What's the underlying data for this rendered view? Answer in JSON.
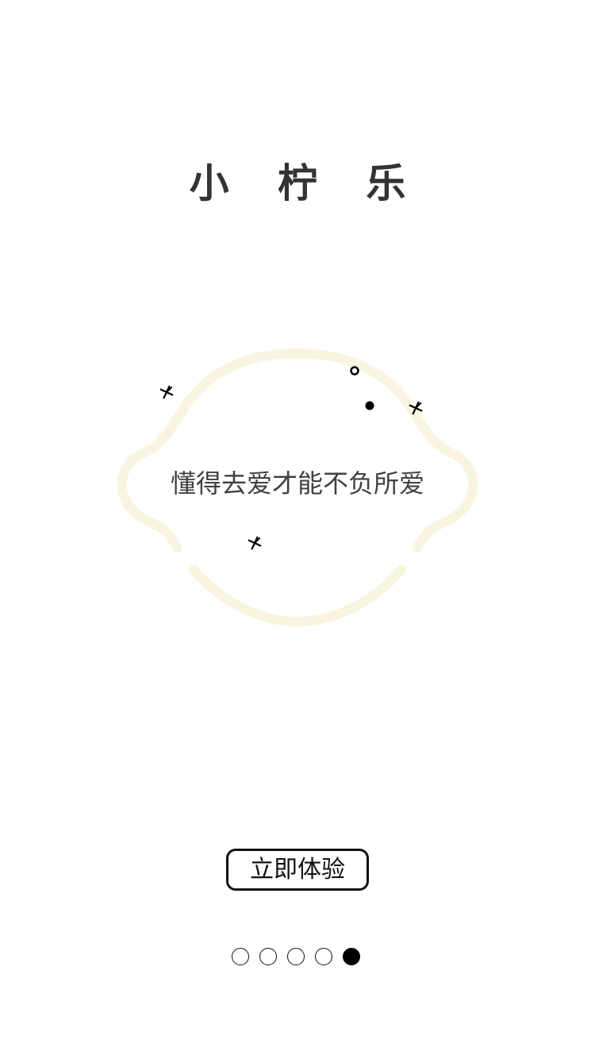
{
  "app": {
    "title": "小 柠 乐",
    "slogan": "懂得去爱才能不负所爱"
  },
  "cta": {
    "label": "立即体验"
  },
  "pager": {
    "total": 5,
    "current": 5
  },
  "colors": {
    "lemon_outline": "#f8f4df",
    "text": "#333333",
    "button_border": "#111111",
    "dot_active": "#000000"
  },
  "icons": {
    "sparkle": "sparkle-icon",
    "ring": "ring-icon",
    "dot": "dot-icon"
  }
}
